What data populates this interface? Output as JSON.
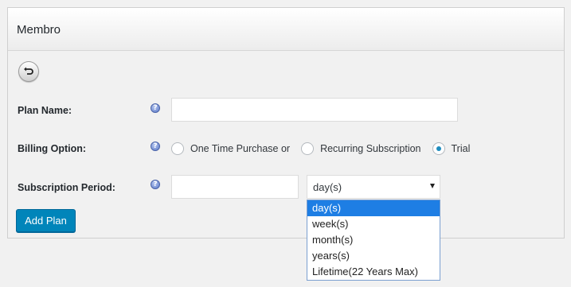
{
  "panel": {
    "title": "Membro"
  },
  "form": {
    "plan_name": {
      "label": "Plan Name:",
      "value": "",
      "help": "?"
    },
    "billing_option": {
      "label": "Billing Option:",
      "help": "?",
      "options": [
        {
          "label": "One Time Purchase or",
          "checked": false
        },
        {
          "label": "Recurring Subscription",
          "checked": false
        },
        {
          "label": "Trial",
          "checked": true
        }
      ]
    },
    "subscription_period": {
      "label": "Subscription Period:",
      "help": "?",
      "value": "",
      "unit_selected": "day(s)",
      "unit_options": [
        "day(s)",
        "week(s)",
        "month(s)",
        "years(s)",
        "Lifetime(22 Years Max)"
      ]
    },
    "submit_label": "Add Plan"
  },
  "colors": {
    "primary_button": "#0085ba",
    "radio_checked": "#1e8cbe",
    "dropdown_highlight": "#1e7ee4"
  }
}
